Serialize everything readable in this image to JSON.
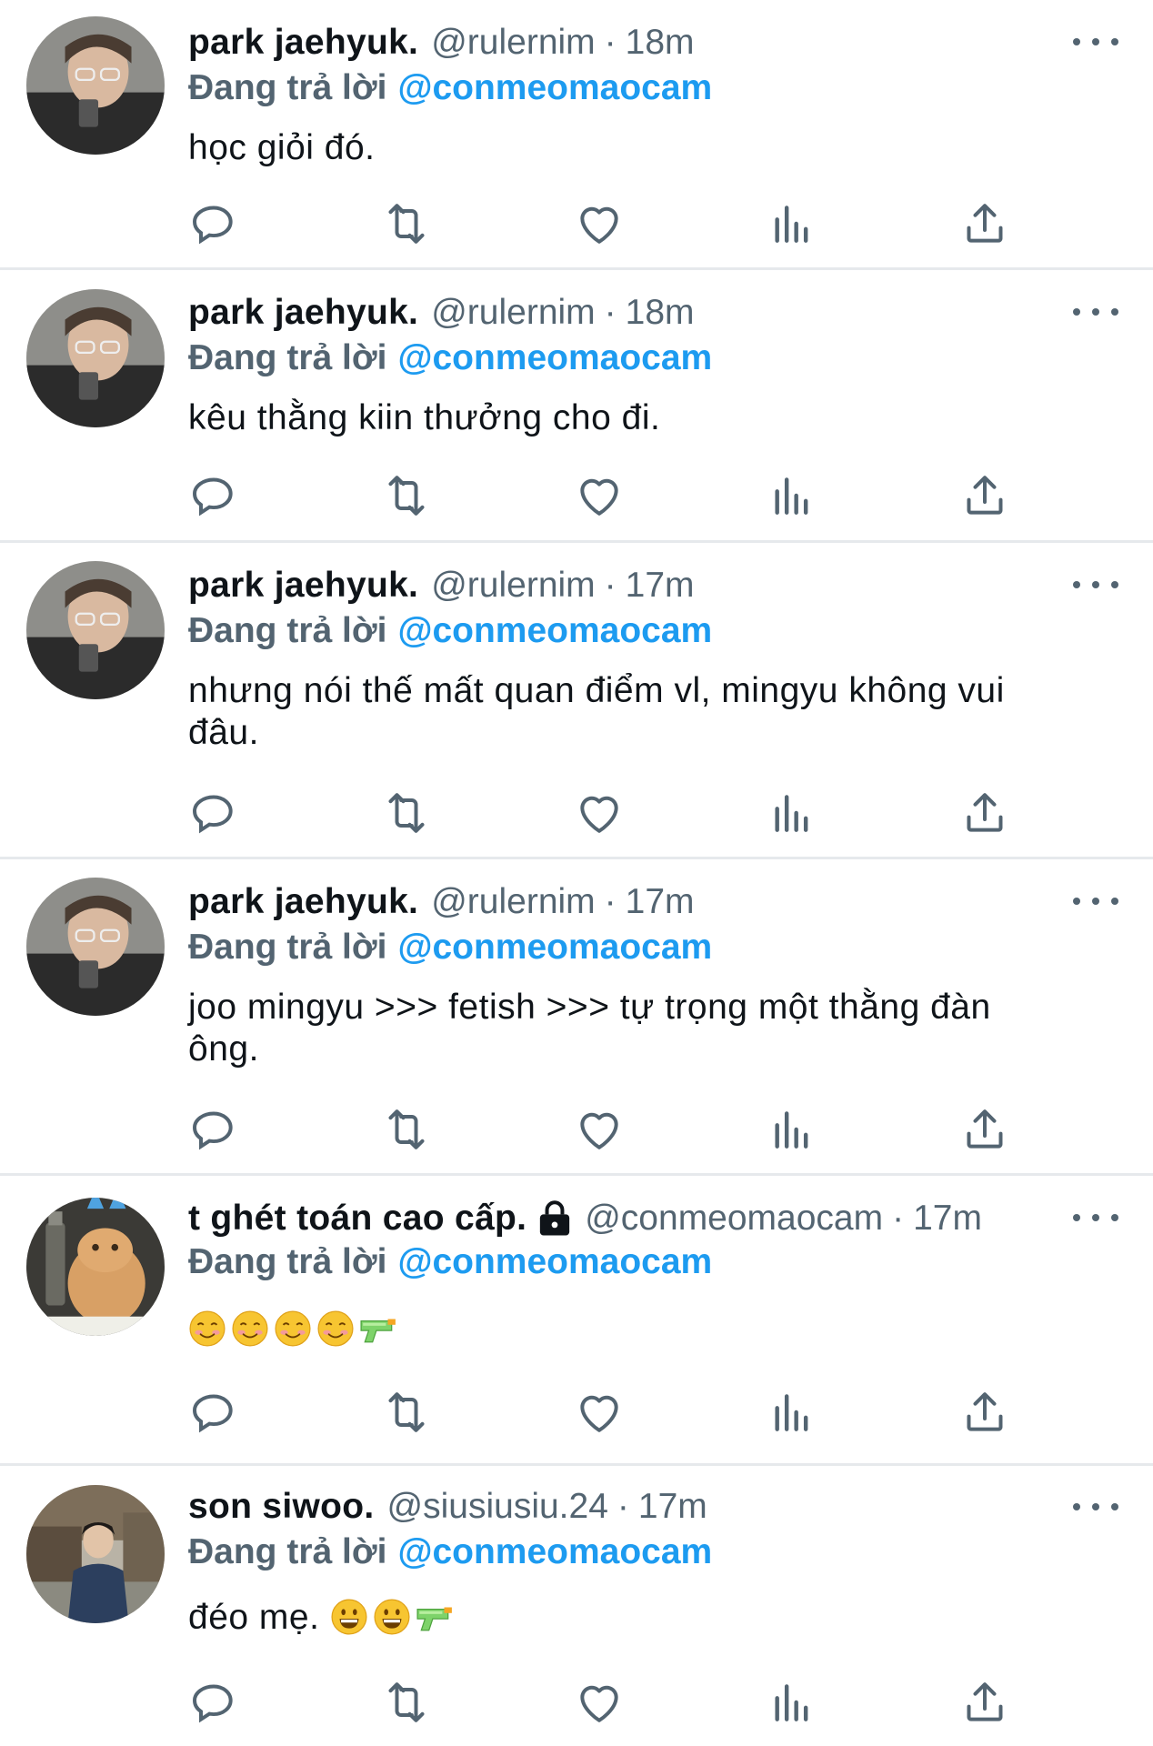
{
  "colors": {
    "handle_gray": "#536471",
    "link_blue": "#1d9bf0",
    "divider": "#e6e9ec"
  },
  "icons": [
    "reply-icon",
    "retweet-icon",
    "like-icon",
    "views-icon",
    "share-icon",
    "more-icon",
    "lock-icon",
    "smiling-face-emoji",
    "water-pistol-emoji",
    "grinning-face-emoji"
  ],
  "tweets": [
    {
      "name": "park jaehyuk.",
      "handle": "@rulernim",
      "sep": "·",
      "time": "18m",
      "reply_label": "Đang trả lời",
      "reply_to": "@conmeomaocam",
      "text": "học giỏi đó."
    },
    {
      "name": "park jaehyuk.",
      "handle": "@rulernim",
      "sep": "·",
      "time": "18m",
      "reply_label": "Đang trả lời",
      "reply_to": "@conmeomaocam",
      "text": "kêu thằng kiin thưởng cho đi."
    },
    {
      "name": "park jaehyuk.",
      "handle": "@rulernim",
      "sep": "·",
      "time": "17m",
      "reply_label": "Đang trả lời",
      "reply_to": "@conmeomaocam",
      "text_line1": "nhưng nói thế mất quan điểm vl, mingyu không vui",
      "text_line2": "đâu."
    },
    {
      "name": "park jaehyuk.",
      "handle": "@rulernim",
      "sep": "·",
      "time": "17m",
      "reply_label": "Đang trả lời",
      "reply_to": "@conmeomaocam",
      "text_line1": "joo mingyu >>> fetish >>> tự trọng một thằng đàn",
      "text_line2": "ông."
    },
    {
      "name": "t ghét toán cao cấp.",
      "handle": "@conmeomaocam",
      "sep": "·",
      "time": "17m",
      "reply_label": "Đang trả lời",
      "reply_to": "@conmeomaocam",
      "text": ""
    },
    {
      "name": "son siwoo.",
      "handle": "@siusiusiu.24",
      "sep": "·",
      "time": "17m",
      "reply_label": "Đang trả lời",
      "reply_to": "@conmeomaocam",
      "text": "đéo mẹ."
    }
  ]
}
